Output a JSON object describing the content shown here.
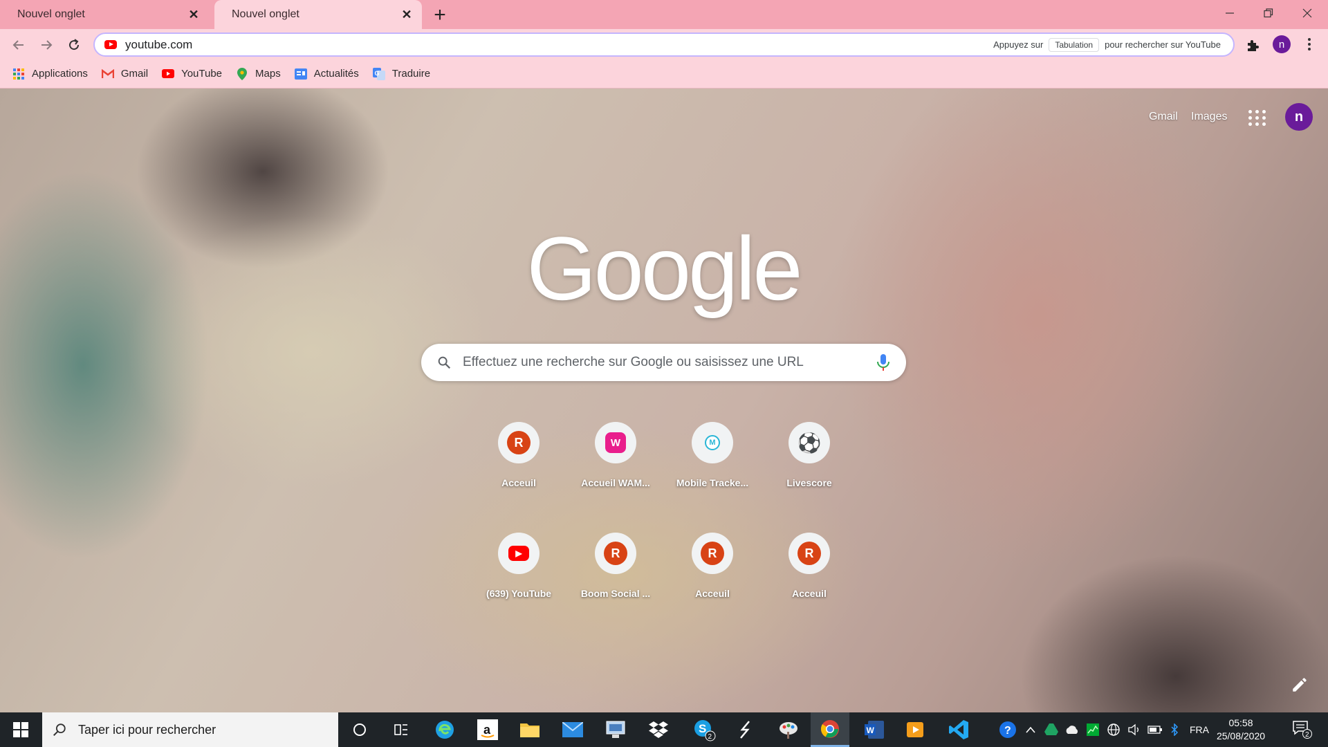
{
  "browser": {
    "tabs": [
      {
        "title": "Nouvel onglet",
        "active": false
      },
      {
        "title": "Nouvel onglet",
        "active": true
      }
    ],
    "omnibox": {
      "url": "youtube.com",
      "hint_prefix": "Appuyez sur",
      "hint_key": "Tabulation",
      "hint_suffix": "pour rechercher sur YouTube"
    },
    "profile_initial": "n",
    "bookmarks": [
      {
        "label": "Applications",
        "icon": "apps-grid-icon"
      },
      {
        "label": "Gmail",
        "icon": "gmail-icon"
      },
      {
        "label": "YouTube",
        "icon": "youtube-icon"
      },
      {
        "label": "Maps",
        "icon": "maps-pin-icon"
      },
      {
        "label": "Actualités",
        "icon": "news-icon"
      },
      {
        "label": "Traduire",
        "icon": "translate-icon"
      }
    ]
  },
  "newtab": {
    "links": {
      "gmail": "Gmail",
      "images": "Images"
    },
    "account_initial": "n",
    "logo_text": "Google",
    "search_placeholder": "Effectuez une recherche sur Google ou saisissez une URL",
    "shortcuts": [
      {
        "label": "Acceuil",
        "badge": "R",
        "color": "#d84315"
      },
      {
        "label": "Accueil WAM...",
        "badge": "W",
        "color": "#e91e8c"
      },
      {
        "label": "Mobile Tracke...",
        "badge": "M",
        "color": "#29b6d6"
      },
      {
        "label": "Livescore",
        "badge": "⚽",
        "color": "#ffffff"
      },
      {
        "label": "(639) YouTube",
        "badge": "▶",
        "color": "#ff0000"
      },
      {
        "label": "Boom Social ...",
        "badge": "R",
        "color": "#d84315"
      },
      {
        "label": "Acceuil",
        "badge": "R",
        "color": "#d84315"
      },
      {
        "label": "Acceuil",
        "badge": "R",
        "color": "#d84315"
      }
    ]
  },
  "taskbar": {
    "search_placeholder": "Taper ici pour rechercher",
    "skype_badge": "2",
    "language": "FRA",
    "time": "05:58",
    "date": "25/08/2020",
    "notifications_count": "2"
  }
}
